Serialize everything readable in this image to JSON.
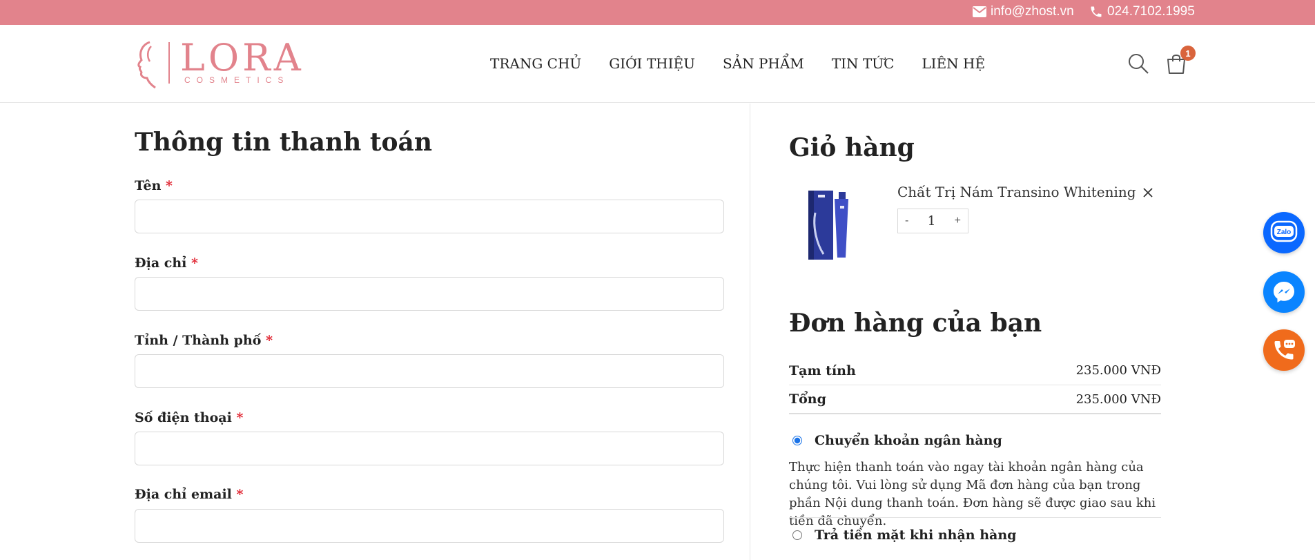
{
  "topbar": {
    "email": "info@zhost.vn",
    "phone": "024.7102.1995",
    "bg_color": "#e2838c"
  },
  "header": {
    "logo": {
      "brand": "LORA",
      "sub": "COSMETICS"
    },
    "nav": [
      "TRANG CHỦ",
      "GIỚI THIỆU",
      "SẢN PHẨM",
      "TIN TỨC",
      "LIÊN HỆ"
    ],
    "cart_count": "1",
    "icons": [
      "search-icon",
      "shopping-bag-icon"
    ]
  },
  "billing": {
    "title": "Thông tin thanh toán",
    "required_mark": "*",
    "fields": [
      {
        "label": "Tên",
        "value": "",
        "placeholder": ""
      },
      {
        "label": "Địa chỉ",
        "value": "",
        "placeholder": ""
      },
      {
        "label": "Tỉnh / Thành phố",
        "value": "",
        "placeholder": ""
      },
      {
        "label": "Số điện thoại",
        "value": "",
        "placeholder": ""
      },
      {
        "label": "Địa chỉ email",
        "value": "",
        "placeholder": ""
      }
    ]
  },
  "cart": {
    "title": "Giỏ hàng",
    "item": {
      "name": "Chất Trị Nám Transino Whitening",
      "qty": "1",
      "minus": "-",
      "plus": "+"
    }
  },
  "order": {
    "title": "Đơn hàng của bạn",
    "subtotal_label": "Tạm tính",
    "subtotal_value": "235.000 VNĐ",
    "total_label": "Tổng",
    "total_value": "235.000 VNĐ"
  },
  "payment": {
    "options": [
      {
        "label": "Chuyển khoản ngân hàng",
        "selected": true
      },
      {
        "label": "Trả tiền mặt khi nhận hàng",
        "selected": false
      }
    ],
    "bank_desc": "Thực hiện thanh toán vào ngay tài khoản ngân hàng của chúng tôi. Vui lòng sử dụng Mã đơn hàng của bạn trong phần Nội dung thanh toán. Đơn hàng sẽ được giao sau khi tiền đã chuyển."
  },
  "floating": {
    "zalo_label": "Zalo",
    "icons": [
      "zalo-icon",
      "messenger-icon",
      "phone-call-icon"
    ]
  }
}
